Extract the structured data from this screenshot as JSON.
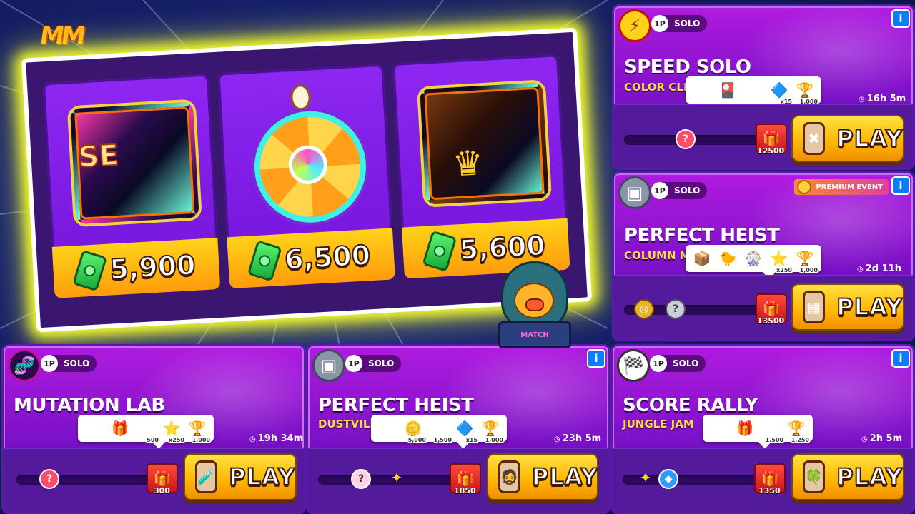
{
  "logo": "MM",
  "offers": [
    {
      "label": "SE",
      "price": "5,900",
      "icon": "special-event-chest"
    },
    {
      "label": "",
      "price": "6,500",
      "icon": "prize-wheel"
    },
    {
      "label": "",
      "price": "5,600",
      "icon": "crown-chest"
    }
  ],
  "mascot_label": "MATCH",
  "events": [
    {
      "key": "speed-solo",
      "title": "SPEED SOLO",
      "subtitle": "COLOR CLIM",
      "mode": "SOLO",
      "badge": "1P",
      "timer": "16h 5m",
      "goal": "12500",
      "play": "PLAY",
      "rewards": [
        {
          "icon": "unknown-card-icon",
          "q": ""
        },
        {
          "icon": "card-pack-icon",
          "q": ""
        },
        {
          "icon": "character-card-icon",
          "q": ""
        },
        {
          "icon": "token-icon",
          "q": "x15"
        },
        {
          "icon": "trophy-icon",
          "q": "1,000"
        }
      ]
    },
    {
      "key": "perfect-heist-1",
      "title": "PERFECT HEIST",
      "subtitle": "COLUMN MA",
      "mode": "SOLO",
      "badge": "1P",
      "timer": "2d 11h",
      "goal": "13500",
      "play": "PLAY",
      "premium": "PREMIUM EVENT",
      "rewards": [
        {
          "icon": "chest-icon",
          "q": ""
        },
        {
          "icon": "duck-icon",
          "q": ""
        },
        {
          "icon": "wheel-icon",
          "q": ""
        },
        {
          "icon": "star-icon",
          "q": "x250"
        },
        {
          "icon": "trophy-icon",
          "q": "1,000"
        }
      ]
    },
    {
      "key": "mutation-lab",
      "title": "MUTATION LAB",
      "subtitle": "",
      "mode": "SOLO",
      "badge": "1P",
      "timer": "19h 34m",
      "goal": "300",
      "play": "PLAY",
      "rewards": [
        {
          "icon": "unknown-card-icon",
          "q": ""
        },
        {
          "icon": "se-chest-icon",
          "q": ""
        },
        {
          "icon": "lightning-icon",
          "q": "500"
        },
        {
          "icon": "star-icon",
          "q": "x250"
        },
        {
          "icon": "trophy-icon",
          "q": "1,000"
        }
      ]
    },
    {
      "key": "perfect-heist-2",
      "title": "PERFECT HEIST",
      "subtitle": "DUSTVILL",
      "mode": "SOLO",
      "badge": "1P",
      "timer": "23h 5m",
      "goal": "1850",
      "play": "PLAY",
      "rewards": [
        {
          "icon": "unknown-card-icon",
          "q": ""
        },
        {
          "icon": "gold-coins-icon",
          "q": "5,000"
        },
        {
          "icon": "lightning-icon",
          "q": "1,500"
        },
        {
          "icon": "token-icon",
          "q": "x15"
        },
        {
          "icon": "trophy-icon",
          "q": "1,000"
        }
      ]
    },
    {
      "key": "score-rally",
      "title": "SCORE RALLY",
      "subtitle": "JUNGLE JAM",
      "mode": "SOLO",
      "badge": "1P",
      "timer": "2h 5m",
      "goal": "1350",
      "play": "PLAY",
      "rewards": [
        {
          "icon": "unknown-card-icon",
          "q": ""
        },
        {
          "icon": "se-chest-icon",
          "q": ""
        },
        {
          "icon": "lightning-icon",
          "q": "1,500"
        },
        {
          "icon": "trophy-icon",
          "q": "1,250"
        }
      ]
    }
  ]
}
